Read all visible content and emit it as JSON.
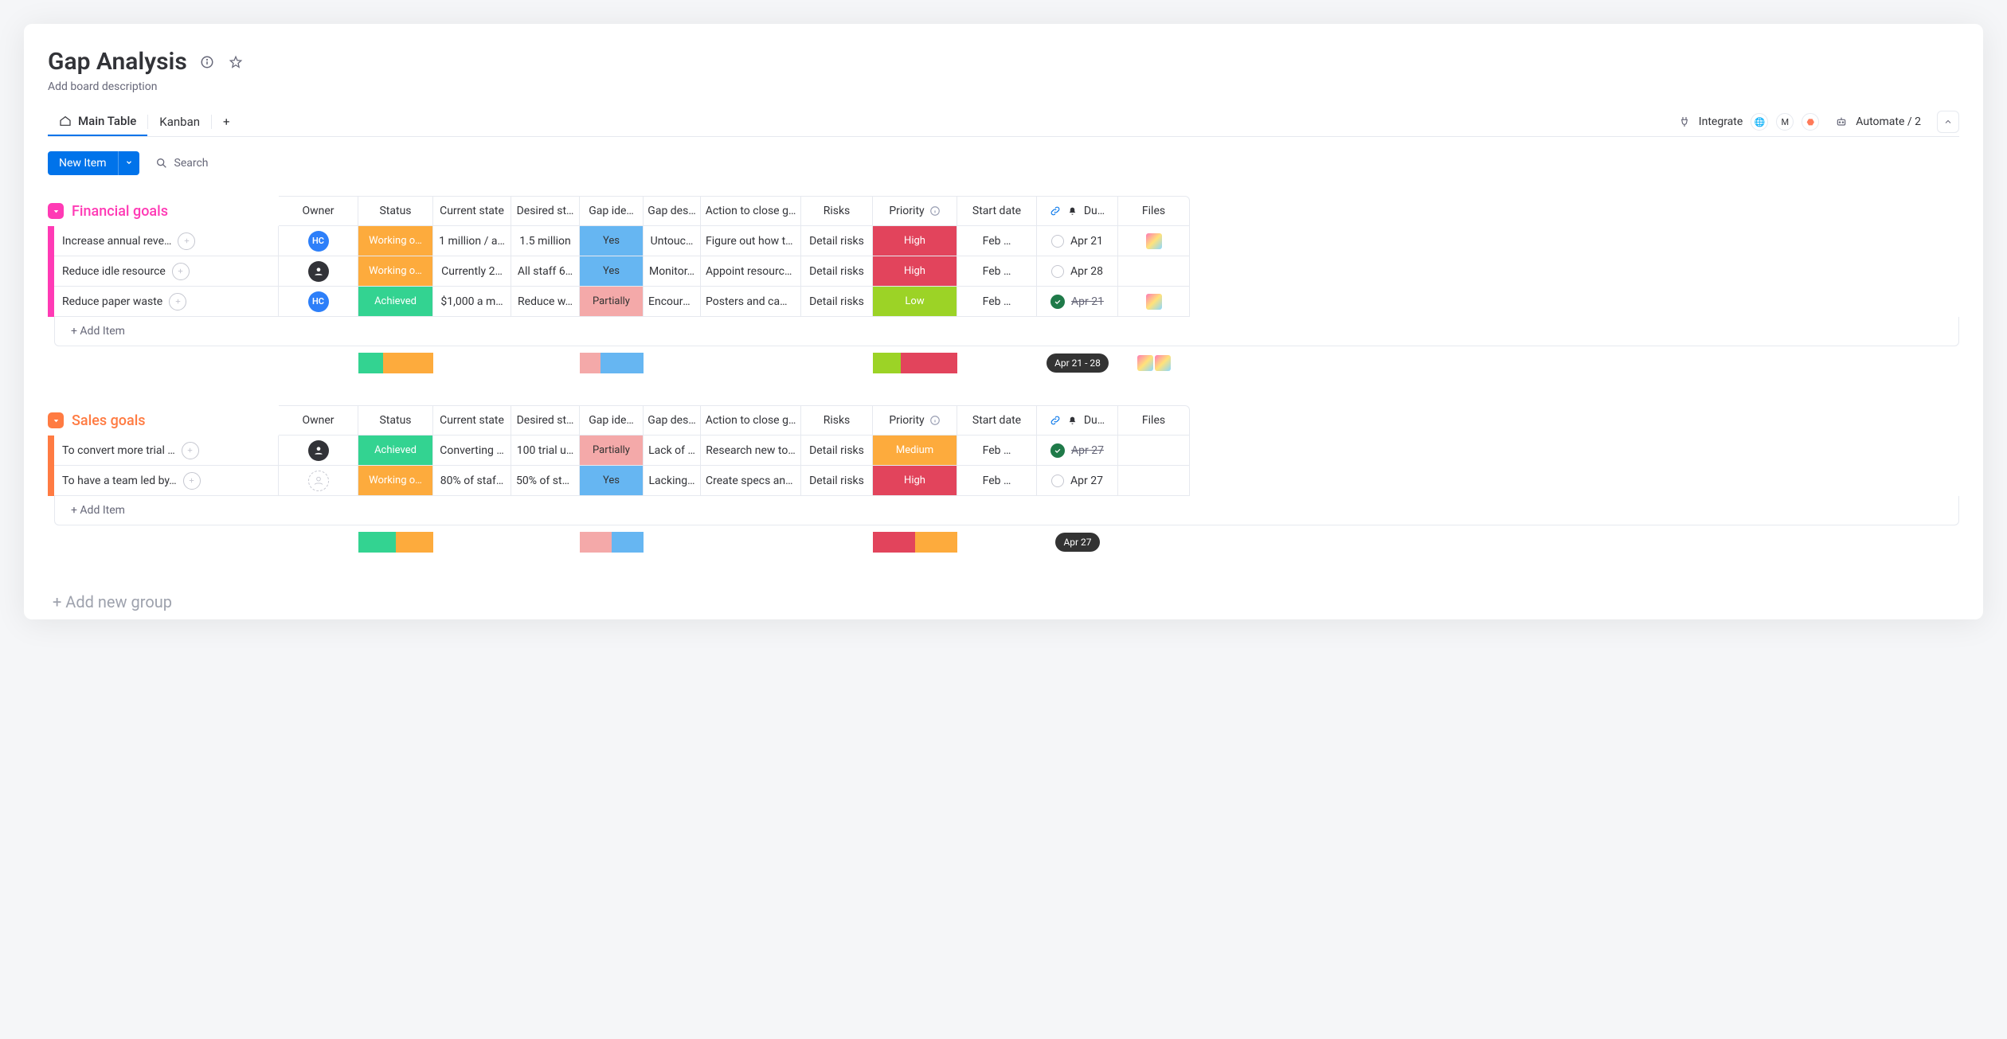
{
  "board": {
    "title": "Gap Analysis",
    "description_placeholder": "Add board description",
    "tabs": {
      "main": "Main Table",
      "kanban": "Kanban"
    },
    "integrate_label": "Integrate",
    "automate_label": "Automate / 2",
    "new_item_label": "New Item",
    "search_label": "Search",
    "add_new_group": "+ Add new group"
  },
  "columns": {
    "owner": "Owner",
    "status": "Status",
    "current": "Current state",
    "desired": "Desired st…",
    "gap_id": "Gap ide…",
    "gap_des": "Gap des…",
    "action": "Action to close g…",
    "risks": "Risks",
    "priority": "Priority",
    "start": "Start date",
    "due": "Du…",
    "files": "Files"
  },
  "status_colors": {
    "working": "#fdab3d",
    "achieved": "#33d391",
    "yes": "#66b6f2",
    "partially": "#f4a9a9",
    "high": "#e2445c",
    "medium": "#fdab3d",
    "low": "#9cd326"
  },
  "groups": [
    {
      "name": "Financial goals",
      "color": "#ff3ab5",
      "color_light": "#ffa8e1",
      "add_label": "+ Add Item",
      "summary": {
        "status_segments": [
          [
            "#33d391",
            0.33
          ],
          [
            "#fdab3d",
            0.67
          ]
        ],
        "gap_segments": [
          [
            "#f4a9a9",
            0.33
          ],
          [
            "#66b6f2",
            0.67
          ]
        ],
        "priority_segments": [
          [
            "#9cd326",
            0.33
          ],
          [
            "#e2445c",
            0.67
          ]
        ],
        "date_range": "Apr 21 - 28",
        "files": 2
      },
      "rows": [
        {
          "name": "Increase annual reve…",
          "owner": {
            "type": "hc",
            "text": "HC"
          },
          "status": {
            "label": "Working o…",
            "key": "working"
          },
          "current": "1 million / a…",
          "desired": "1.5 million",
          "gap_id": {
            "label": "Yes",
            "key": "yes"
          },
          "gap_des": "Untouc…",
          "action": "Figure out how to…",
          "risks": "Detail risks",
          "priority": {
            "label": "High",
            "key": "high"
          },
          "start": "Feb …",
          "due": {
            "text": "Apr 21",
            "done": false
          },
          "file": true
        },
        {
          "name": "Reduce idle resource",
          "owner": {
            "type": "anon"
          },
          "status": {
            "label": "Working o…",
            "key": "working"
          },
          "current": "Currently 2…",
          "desired": "All staff 6…",
          "gap_id": {
            "label": "Yes",
            "key": "yes"
          },
          "gap_des": "Monitor…",
          "action": "Appoint resource …",
          "risks": "Detail risks",
          "priority": {
            "label": "High",
            "key": "high"
          },
          "start": "Feb …",
          "due": {
            "text": "Apr 28",
            "done": false
          },
          "file": false
        },
        {
          "name": "Reduce paper waste",
          "owner": {
            "type": "hc",
            "text": "HC"
          },
          "status": {
            "label": "Achieved",
            "key": "achieved"
          },
          "current": "$1,000 a m…",
          "desired": "Reduce w…",
          "gap_id": {
            "label": "Partially",
            "key": "partially"
          },
          "gap_des": "Encoura…",
          "action": "Posters and cam…",
          "risks": "Detail risks",
          "priority": {
            "label": "Low",
            "key": "low"
          },
          "start": "Feb …",
          "due": {
            "text": "Apr 21",
            "done": true
          },
          "file": true
        }
      ]
    },
    {
      "name": "Sales goals",
      "color": "#ff7b42",
      "color_light": "#ffc2a6",
      "add_label": "+ Add Item",
      "summary": {
        "status_segments": [
          [
            "#33d391",
            0.5
          ],
          [
            "#fdab3d",
            0.5
          ]
        ],
        "gap_segments": [
          [
            "#f4a9a9",
            0.5
          ],
          [
            "#66b6f2",
            0.5
          ]
        ],
        "priority_segments": [
          [
            "#e2445c",
            0.5
          ],
          [
            "#fdab3d",
            0.5
          ]
        ],
        "date_range": "Apr 27",
        "files": 0
      },
      "rows": [
        {
          "name": "To convert more trial …",
          "owner": {
            "type": "anon"
          },
          "status": {
            "label": "Achieved",
            "key": "achieved"
          },
          "current": "Converting …",
          "desired": "100 trial u…",
          "gap_id": {
            "label": "Partially",
            "key": "partially"
          },
          "gap_des": "Lack of …",
          "action": "Research new to…",
          "risks": "Detail risks",
          "priority": {
            "label": "Medium",
            "key": "medium"
          },
          "start": "Feb …",
          "due": {
            "text": "Apr 27",
            "done": true
          },
          "file": false
        },
        {
          "name": "To have a team led by…",
          "owner": {
            "type": "empty"
          },
          "status": {
            "label": "Working o…",
            "key": "working"
          },
          "current": "80% of staf…",
          "desired": "50% of sta…",
          "gap_id": {
            "label": "Yes",
            "key": "yes"
          },
          "gap_des": "Lacking…",
          "action": "Create specs and…",
          "risks": "Detail risks",
          "priority": {
            "label": "High",
            "key": "high"
          },
          "start": "Feb …",
          "due": {
            "text": "Apr 27",
            "done": false
          },
          "file": false
        }
      ]
    }
  ]
}
